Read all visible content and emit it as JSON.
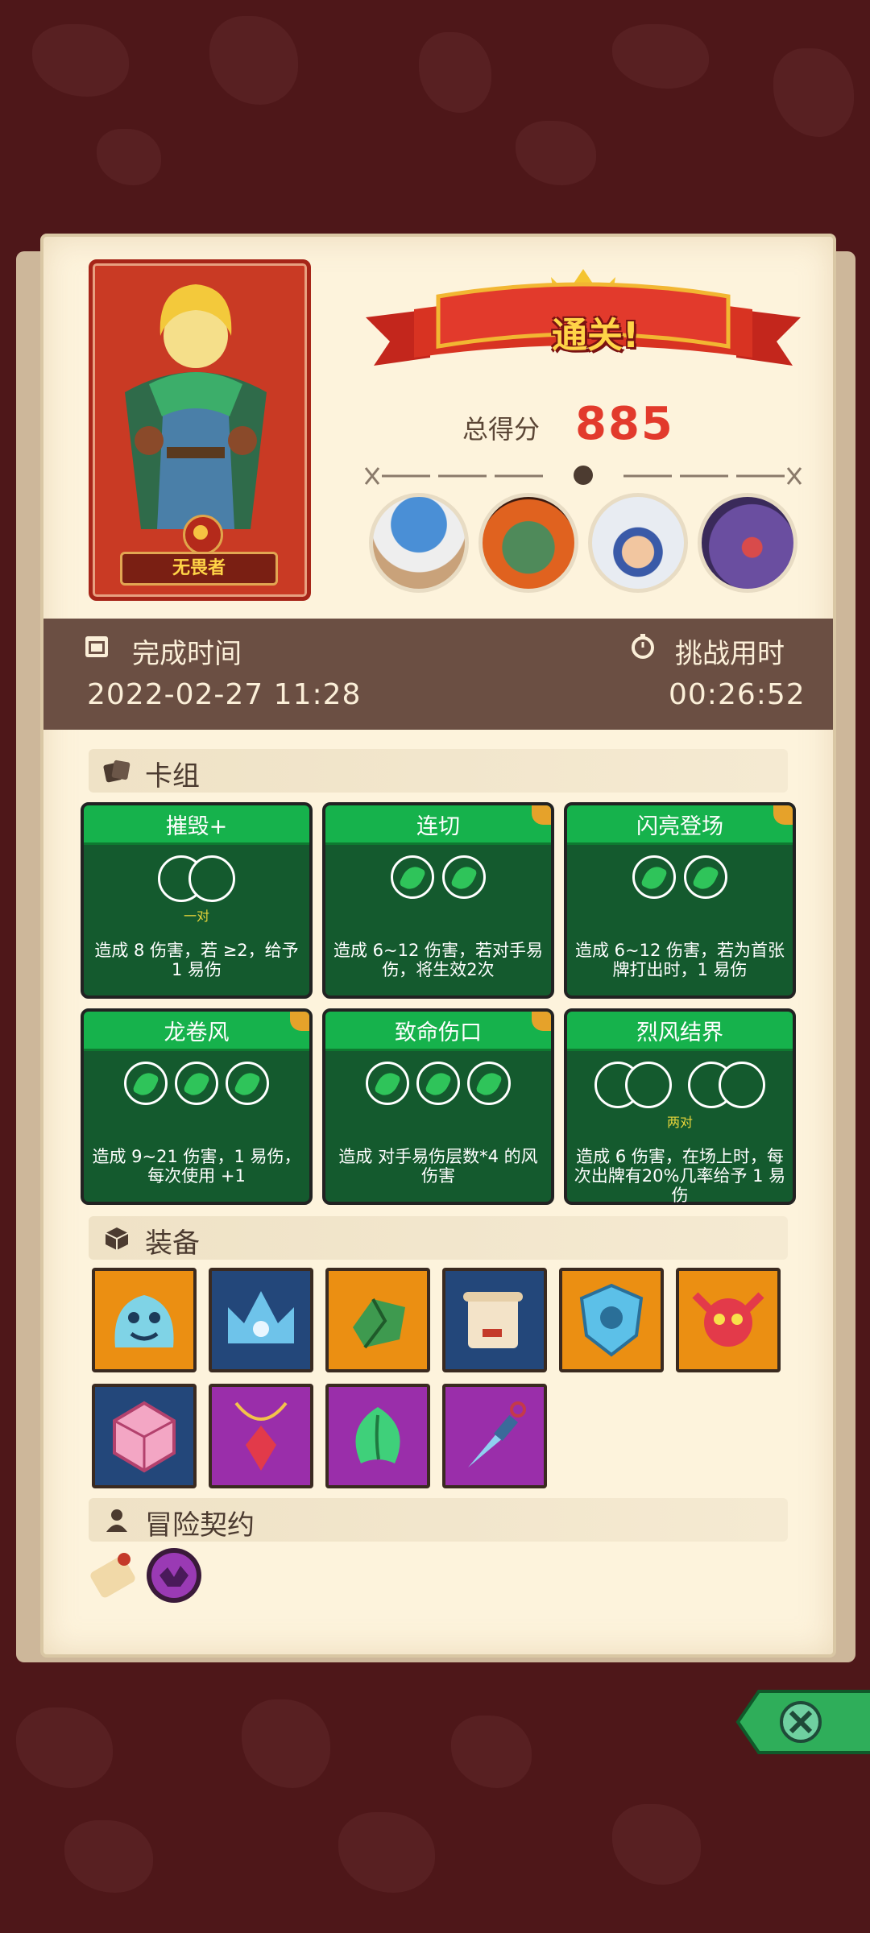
{
  "hero": {
    "name": "无畏者"
  },
  "result": {
    "title": "通关!",
    "score_label": "总得分",
    "score": "885"
  },
  "bosses": [
    {
      "name": "mushroom-sage-boss"
    },
    {
      "name": "orange-troll-boss"
    },
    {
      "name": "blue-snow-beast-boss"
    },
    {
      "name": "purple-dragon-boss"
    }
  ],
  "time": {
    "finish_label": "完成时间",
    "finish_value": "2022-02-27 11:28",
    "challenge_label": "挑战用时",
    "challenge_value": "00:26:52"
  },
  "sections": {
    "deck": "卡组",
    "equipment": "装备",
    "contract": "冒险契约"
  },
  "cards": [
    {
      "name": "摧毁+",
      "slots": "pair",
      "note": "一对",
      "desc": "造成 8 伤害，若 ≥2，给予 1 易伤"
    },
    {
      "name": "连切",
      "slots": "leaf2",
      "note": "",
      "desc": "造成 6~12 伤害，若对手易伤，将生效2次"
    },
    {
      "name": "闪亮登场",
      "slots": "leaf2",
      "note": "",
      "desc": "造成 6~12 伤害，若为首张牌打出时，1 易伤"
    },
    {
      "name": "龙卷风",
      "slots": "leaf3",
      "note": "",
      "desc": "造成 9~21 伤害，1 易伤，每次使用 +1"
    },
    {
      "name": "致命伤口",
      "slots": "leaf3",
      "note": "",
      "desc": "造成 对手易伤层数*4 的风伤害"
    },
    {
      "name": "烈风结界",
      "slots": "twopair",
      "note": "两对",
      "desc": "造成 6 伤害，在场上时，每次出牌有20%几率给予 1 易伤"
    }
  ],
  "equipment": [
    {
      "name": "blue-slime-icon",
      "color": "orange"
    },
    {
      "name": "ice-crown-icon",
      "color": "blue"
    },
    {
      "name": "green-gem-icon",
      "color": "orange"
    },
    {
      "name": "scroll-icon",
      "color": "blue"
    },
    {
      "name": "ice-shield-icon",
      "color": "orange"
    },
    {
      "name": "demon-skull-icon",
      "color": "orange"
    },
    {
      "name": "pink-dice-icon",
      "color": "blue"
    },
    {
      "name": "ruby-amulet-icon",
      "color": "purple"
    },
    {
      "name": "green-leaf-icon",
      "color": "purple"
    },
    {
      "name": "ice-dagger-icon",
      "color": "purple"
    }
  ],
  "contracts": [
    {
      "name": "scroll-contract-icon"
    },
    {
      "name": "purple-curse-icon"
    }
  ],
  "colors": {
    "background": "#4e1719",
    "accent_red": "#e23a2c",
    "card_green": "#16b24c",
    "timebar": "#6b4f43"
  }
}
